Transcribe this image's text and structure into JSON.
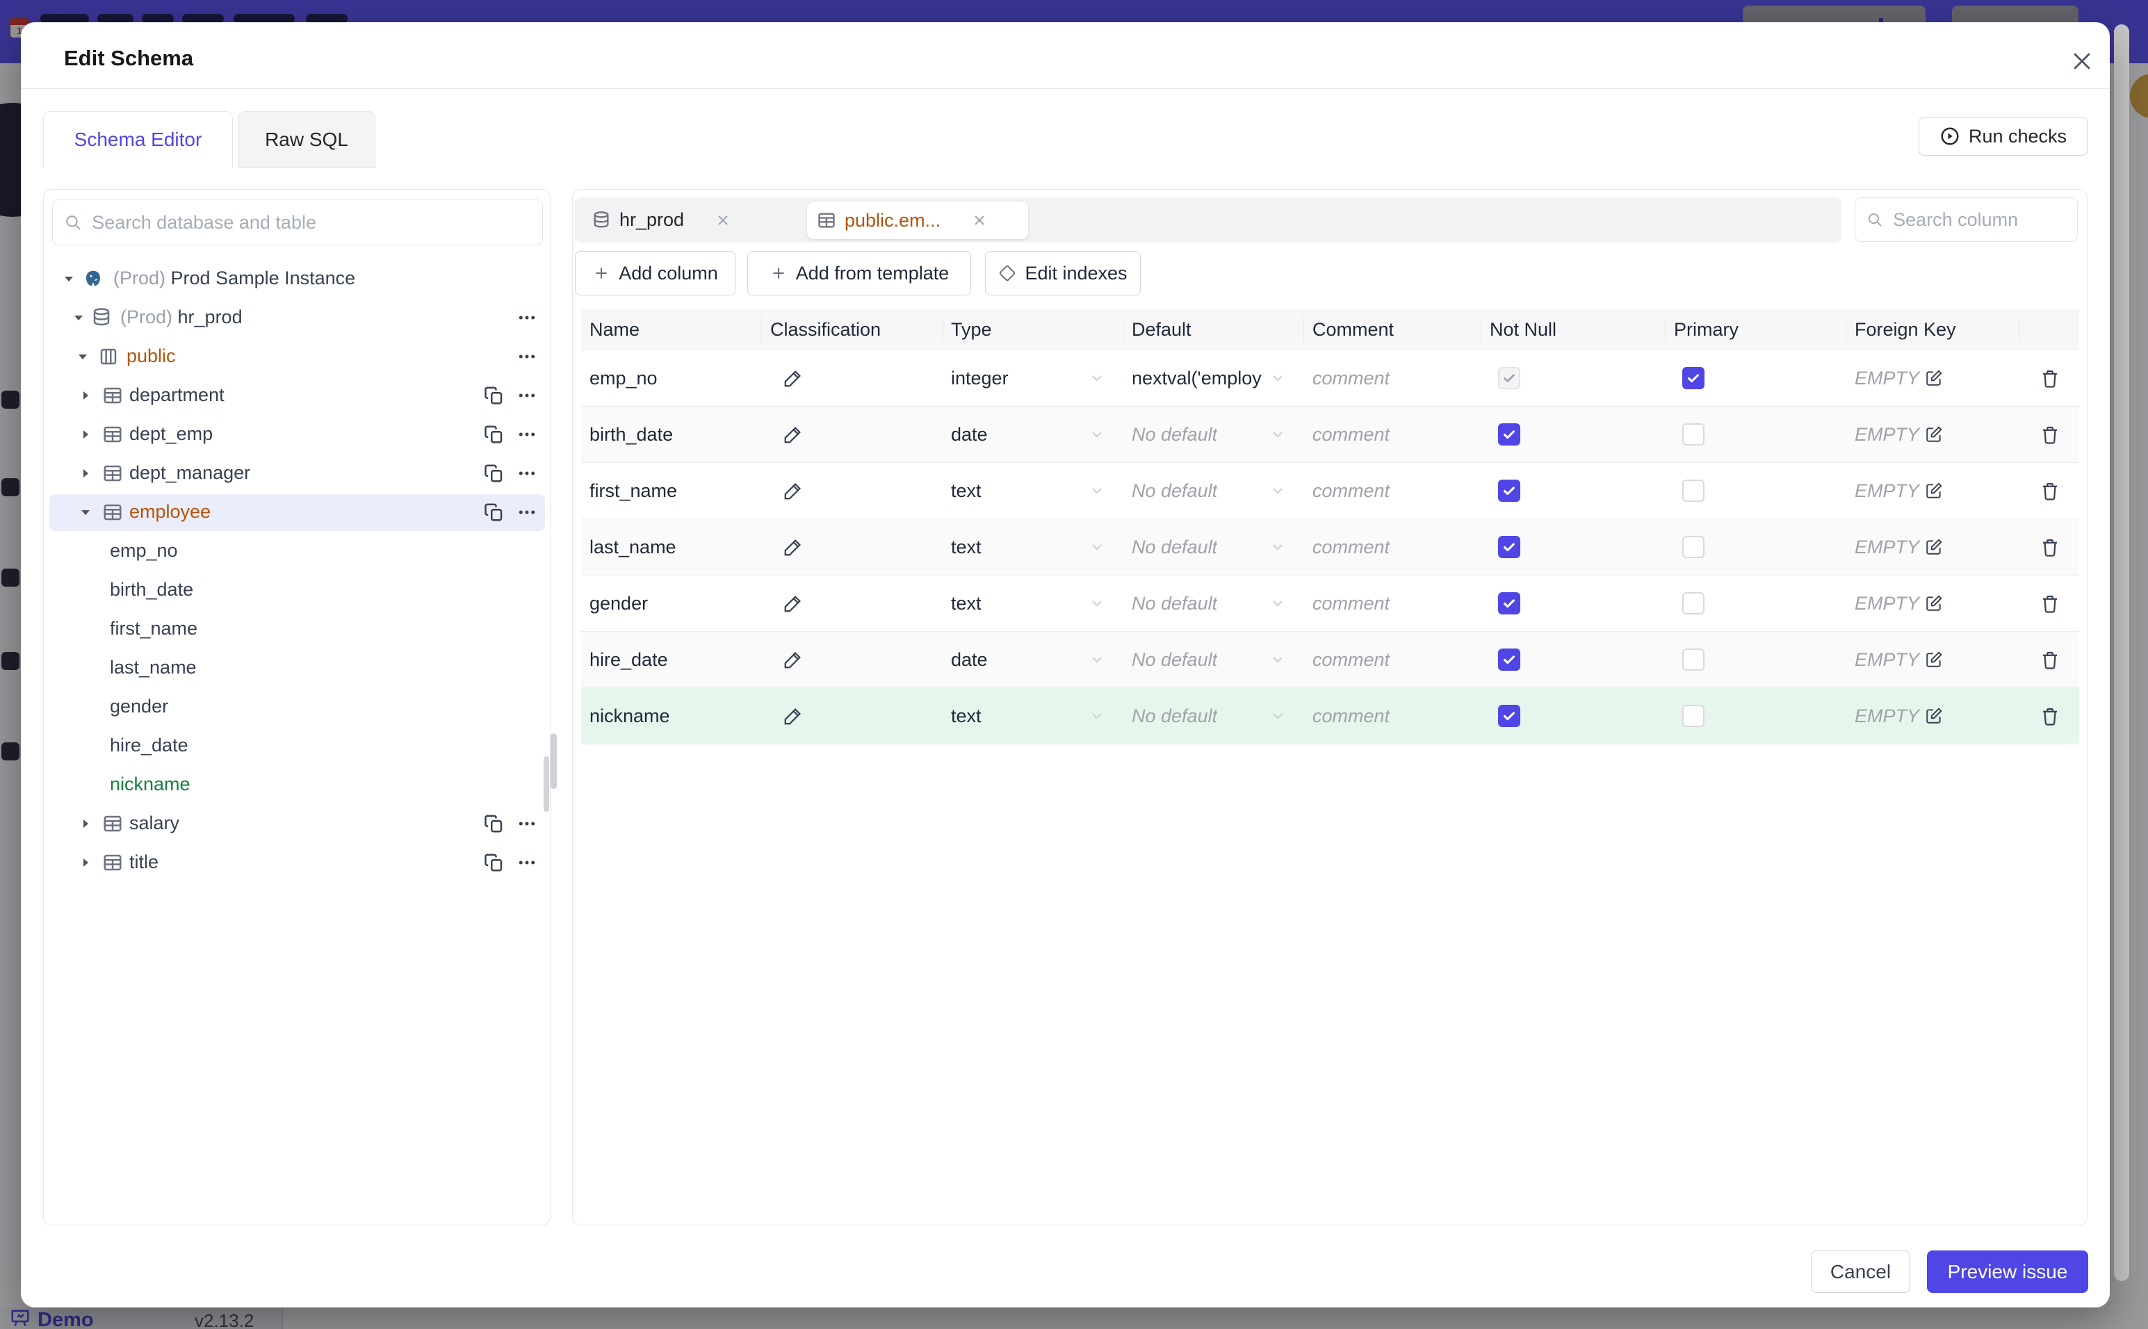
{
  "modal": {
    "title": "Edit Schema",
    "tabs": [
      {
        "label": "Schema Editor",
        "active": true
      },
      {
        "label": "Raw SQL",
        "active": false
      }
    ],
    "run_checks_label": "Run checks",
    "cancel_label": "Cancel",
    "preview_label": "Preview issue"
  },
  "sidebar": {
    "search_placeholder": "Search database and table",
    "tree": [
      {
        "prefix": "(Prod)",
        "label": "Prod Sample Instance",
        "depth": 0,
        "caret": "down",
        "icon": "postgres",
        "actions": []
      },
      {
        "prefix": "(Prod)",
        "label": "hr_prod",
        "depth": 1,
        "caret": "down",
        "icon": "database",
        "actions": [
          "more"
        ]
      },
      {
        "label": "public",
        "depth": 2,
        "caret": "down",
        "icon": "schema",
        "color": "amber",
        "actions": [
          "more"
        ]
      },
      {
        "label": "department",
        "depth": 3,
        "caret": "right",
        "icon": "table",
        "actions": [
          "copy",
          "more"
        ]
      },
      {
        "label": "dept_emp",
        "depth": 3,
        "caret": "right",
        "icon": "table",
        "actions": [
          "copy",
          "more"
        ]
      },
      {
        "label": "dept_manager",
        "depth": 3,
        "caret": "right",
        "icon": "table",
        "actions": [
          "copy",
          "more"
        ]
      },
      {
        "label": "employee",
        "depth": 3,
        "caret": "down",
        "icon": "table",
        "color": "amber",
        "selected": true,
        "actions": [
          "copy",
          "more"
        ]
      },
      {
        "label": "emp_no",
        "depth": 4
      },
      {
        "label": "birth_date",
        "depth": 4
      },
      {
        "label": "first_name",
        "depth": 4
      },
      {
        "label": "last_name",
        "depth": 4
      },
      {
        "label": "gender",
        "depth": 4
      },
      {
        "label": "hire_date",
        "depth": 4
      },
      {
        "label": "nickname",
        "depth": 4,
        "color": "green"
      },
      {
        "label": "salary",
        "depth": 3,
        "caret": "right",
        "icon": "table",
        "actions": [
          "copy",
          "more"
        ]
      },
      {
        "label": "title",
        "depth": 3,
        "caret": "right",
        "icon": "table",
        "actions": [
          "copy",
          "more"
        ]
      }
    ]
  },
  "editor": {
    "chips": [
      {
        "label": "hr_prod",
        "icon": "database",
        "active": false
      },
      {
        "label": "public.em...",
        "icon": "table",
        "active": true
      }
    ],
    "search_placeholder": "Search column",
    "toolbar": [
      {
        "label": "Add column",
        "icon": "plus"
      },
      {
        "label": "Add from template",
        "icon": "plus"
      },
      {
        "label": "Edit indexes",
        "icon": "diamond"
      }
    ],
    "table": {
      "headers": [
        "Name",
        "Classification",
        "Type",
        "Default",
        "Comment",
        "Not Null",
        "Primary",
        "Foreign Key",
        ""
      ],
      "comment_placeholder": "comment",
      "fk_label": "EMPTY",
      "rows": [
        {
          "name": "emp_no",
          "type": "integer",
          "default": "nextval('employ",
          "default_set": true,
          "not_null": "disabled",
          "primary": true,
          "state": "normal"
        },
        {
          "name": "birth_date",
          "type": "date",
          "default": "No default",
          "default_set": false,
          "not_null": "checked",
          "primary": false,
          "state": "normal"
        },
        {
          "name": "first_name",
          "type": "text",
          "default": "No default",
          "default_set": false,
          "not_null": "checked",
          "primary": false,
          "state": "normal"
        },
        {
          "name": "last_name",
          "type": "text",
          "default": "No default",
          "default_set": false,
          "not_null": "checked",
          "primary": false,
          "state": "normal"
        },
        {
          "name": "gender",
          "type": "text",
          "default": "No default",
          "default_set": false,
          "not_null": "checked",
          "primary": false,
          "state": "normal"
        },
        {
          "name": "hire_date",
          "type": "date",
          "default": "No default",
          "default_set": false,
          "not_null": "checked",
          "primary": false,
          "state": "normal"
        },
        {
          "name": "nickname",
          "type": "text",
          "default": "No default",
          "default_set": false,
          "not_null": "checked",
          "primary": false,
          "state": "added"
        }
      ]
    }
  },
  "background": {
    "demo_label": "Demo",
    "version": "v2.13.2"
  },
  "colors": {
    "accent": "#4f46e5",
    "amber": "#b45309",
    "green": "#15803d",
    "added_row_bg": "#e6f6ec",
    "selected_row_bg": "#ebedfa",
    "topbar": "#5a52f0"
  }
}
